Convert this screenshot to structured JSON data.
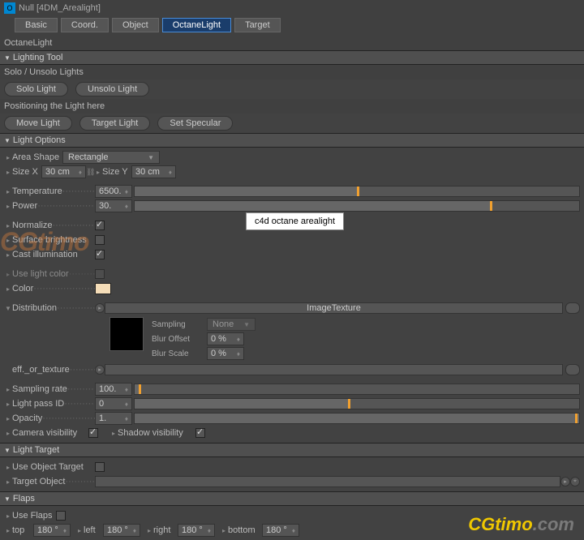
{
  "title": {
    "icon": "O",
    "text": "Null [4DM_Arealight]"
  },
  "tabs": [
    "Basic",
    "Coord.",
    "Object",
    "OctaneLight",
    "Target"
  ],
  "activeTab": "OctaneLight",
  "panelName": "OctaneLight",
  "sections": {
    "lightingTool": {
      "title": "Lighting Tool"
    },
    "solo": {
      "title": "Solo / Unsolo Lights",
      "buttons": {
        "solo": "Solo Light",
        "unsolo": "Unsolo Light"
      }
    },
    "positioning": {
      "title": "Positioning the Light here",
      "buttons": {
        "move": "Move Light",
        "target": "Target Light",
        "spec": "Set Specular"
      }
    },
    "lightOptions": {
      "title": "Light Options",
      "areaShape": {
        "label": "Area Shape",
        "value": "Rectangle"
      },
      "sizeX": {
        "label": "Size X",
        "value": "30 cm"
      },
      "sizeY": {
        "label": "Size Y",
        "value": "30 cm"
      },
      "temperature": {
        "label": "Temperature",
        "value": "6500."
      },
      "power": {
        "label": "Power",
        "value": "30."
      },
      "normalize": {
        "label": "Normalize",
        "checked": true
      },
      "surfaceBrightness": {
        "label": "Surface brightness",
        "checked": false
      },
      "castIllum": {
        "label": "Cast illumination",
        "checked": true
      },
      "useLightColor": {
        "label": "Use light color",
        "checked": false
      },
      "color": {
        "label": "Color"
      },
      "distribution": {
        "label": "Distribution",
        "value": "ImageTexture"
      },
      "sampling": {
        "label": "Sampling",
        "value": "None"
      },
      "blurOffset": {
        "label": "Blur Offset",
        "value": "0 %"
      },
      "blurScale": {
        "label": "Blur Scale",
        "value": "0 %"
      },
      "effOrTexture": {
        "label": "eff._or_texture"
      },
      "samplingRate": {
        "label": "Sampling rate",
        "value": "100."
      },
      "lightPassId": {
        "label": "Light pass ID",
        "value": "0"
      },
      "opacity": {
        "label": "Opacity",
        "value": "1."
      },
      "cameraVis": {
        "label": "Camera visibility",
        "checked": true
      },
      "shadowVis": {
        "label": "Shadow visibility",
        "checked": true
      }
    },
    "lightTarget": {
      "title": "Light Target",
      "useObjTarget": {
        "label": "Use Object Target",
        "checked": false
      },
      "targetObj": {
        "label": "Target Object"
      }
    },
    "flaps": {
      "title": "Flaps",
      "useFlaps": {
        "label": "Use Flaps",
        "checked": false
      },
      "top": {
        "label": "top",
        "value": "180 °"
      },
      "left": {
        "label": "left",
        "value": "180 °"
      },
      "right": {
        "label": "right",
        "value": "180 °"
      },
      "bottom": {
        "label": "bottom",
        "value": "180 °"
      }
    }
  },
  "tooltip": "c4d octane arealight",
  "watermark": {
    "left": "CGtimo",
    "rightA": "CGtimo",
    "rightB": ".com"
  }
}
